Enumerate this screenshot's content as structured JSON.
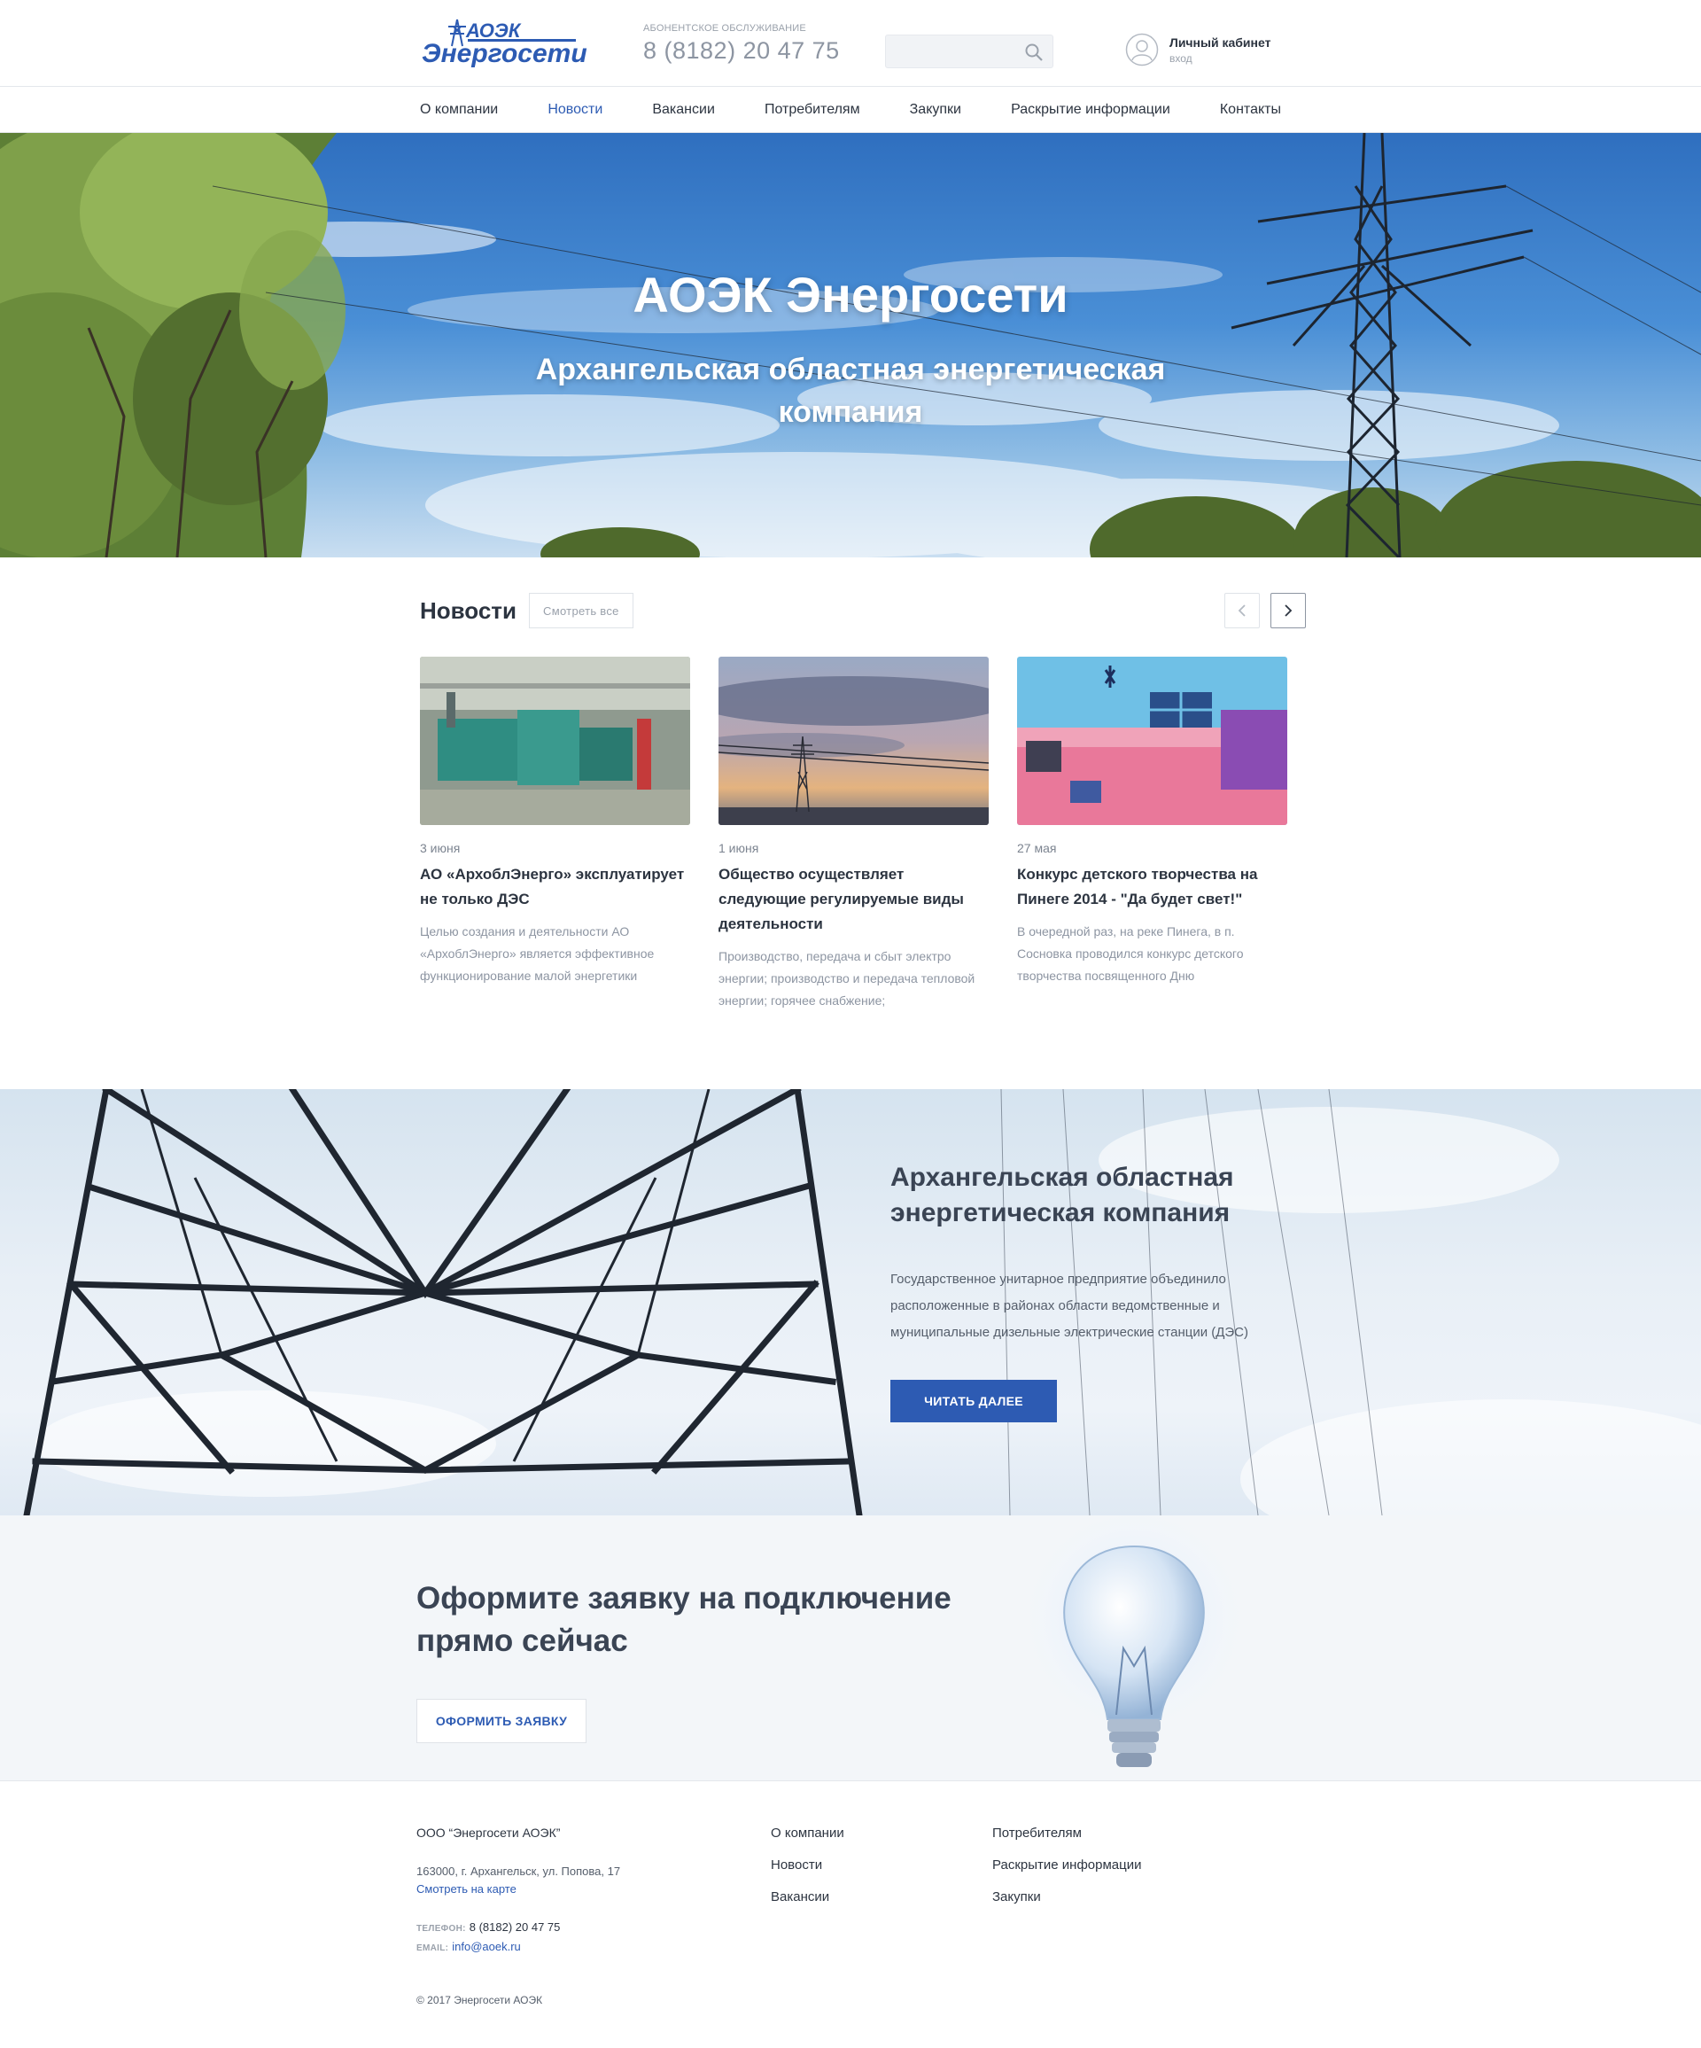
{
  "header": {
    "logo": {
      "text_top": "АОЭК",
      "text_main": "Энергосети"
    },
    "phone_caption": "Абонентское обслуживание",
    "phone": "8 (8182) 20 47 75",
    "search_placeholder": "",
    "account_title": "Личный кабинет",
    "account_sub": "вход"
  },
  "nav": {
    "items": [
      "О компании",
      "Новости",
      "Вакансии",
      "Потребителям",
      "Закупки",
      "Раскрытие информации",
      "Контакты"
    ],
    "active": "Новости"
  },
  "hero": {
    "title": "АОЭК Энергосети",
    "subtitle": "Архангельская областная энергетическая компания"
  },
  "news": {
    "title": "Новости",
    "view_all": "Смотреть все",
    "items": [
      {
        "date": "3 июня",
        "heading": "АО «АрхоблЭнерго» эксплуатирует не только ДЭС",
        "text": "Целью создания и деятельности АО «АрхоблЭнерго» является эффективное функционирование малой энергетики"
      },
      {
        "date": "1 июня",
        "heading": "Общество осуществляет следующие регулируемые виды деятельности",
        "text": "Производство, передача и сбыт электро энергии; производство и передача тепловой энергии; горячее снабжение;"
      },
      {
        "date": "27 мая",
        "heading": "Конкурс детского творчества на Пинеге 2014 - \"Да будет свет!\"",
        "text": "В очередной раз, на реке Пинега, в п. Сосновка проводился конкурс детского творчества посвященного Дню"
      }
    ]
  },
  "about": {
    "title": "Архангельская областная энергетическая компания",
    "text": "Государственное унитарное предприятие объединило расположенные в районах области ведомственные и муниципальные дизельные электрические станции (ДЭС)",
    "button": "Читать далее"
  },
  "apply": {
    "title": "Оформите заявку на подключение прямо сейчас",
    "button": "Оформить заявку"
  },
  "footer": {
    "company": "ООО “Энергосети АОЭК”",
    "address": "163000, г. Архангельск, ул. Попова, 17",
    "map_link": "Смотреть на карте",
    "phone_label": "Телефон:",
    "phone": "8 (8182) 20 47 75",
    "email_label": "Email:",
    "email": "info@aoek.ru",
    "links_col1": [
      "О компании",
      "Новости",
      "Вакансии"
    ],
    "links_col2": [
      "Потребителям",
      "Раскрытие информации",
      "Закупки"
    ],
    "copyright": "© 2017 Энергосети АОЭК"
  },
  "colors": {
    "brand": "#2d5bb3",
    "text_dark": "#2c3440",
    "text_muted": "#8d95a2"
  }
}
